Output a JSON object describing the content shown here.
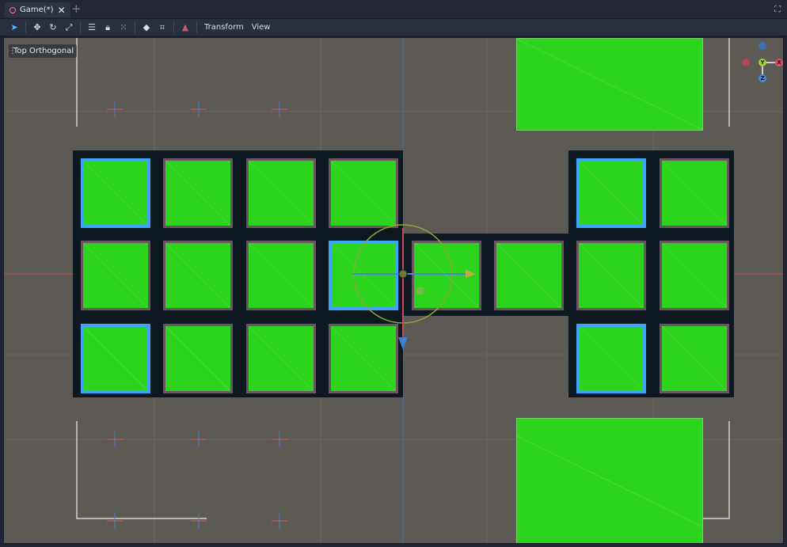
{
  "tab": {
    "title": "Game(*)",
    "close_glyph": "✕",
    "add_glyph": "+"
  },
  "toolbar": {
    "icons": [
      "select-icon",
      "move-icon",
      "rotate-icon",
      "scale-icon",
      "list-icon",
      "lock-icon",
      "group-icon",
      "local-space-icon",
      "snap-icon",
      "camera-icon"
    ],
    "transform_label": "Transform",
    "view_label": "View",
    "fullscreen_glyph": "⛶"
  },
  "viewport": {
    "view_name": "Top Orthogonal",
    "axis_labels": {
      "x": "X",
      "y": "Y",
      "z": "Z"
    },
    "colors": {
      "background": "#5d5a55",
      "tile_fill": "#2dd41d",
      "selection": "#3aa4ff",
      "x_axis": "#e84c5c",
      "y_axis": "#9bd22b",
      "z_axis": "#3d8be8"
    },
    "grid": {
      "rows": 3,
      "cols": 8,
      "missing": [
        [
          0,
          4
        ],
        [
          0,
          5
        ],
        [
          2,
          4
        ],
        [
          2,
          5
        ]
      ],
      "selected": [
        [
          0,
          0
        ],
        [
          0,
          6
        ],
        [
          1,
          3
        ],
        [
          2,
          0
        ],
        [
          2,
          6
        ]
      ]
    }
  }
}
